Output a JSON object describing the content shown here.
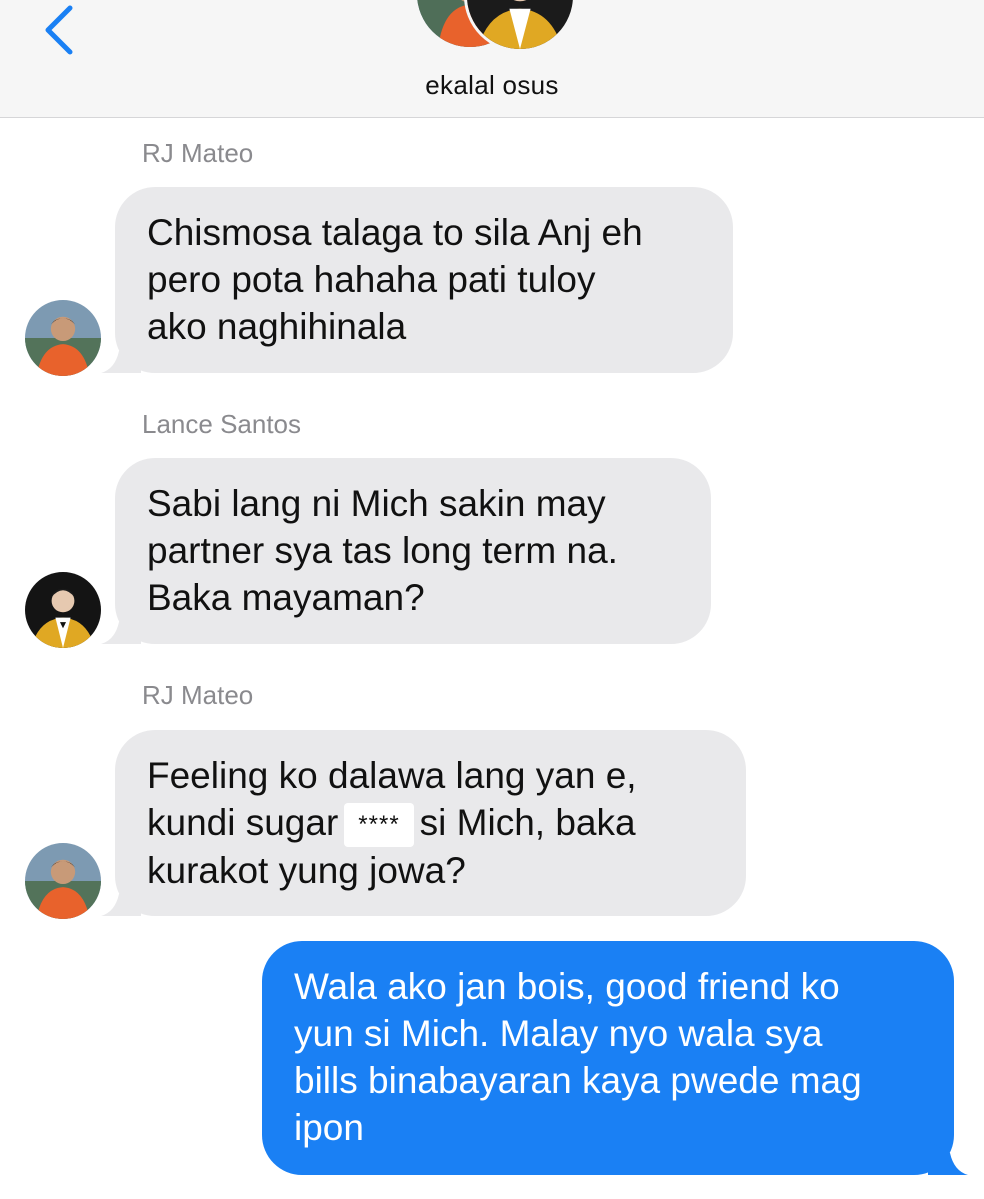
{
  "header": {
    "group_name": "ekalal osus",
    "back_icon": "chevron-left-icon"
  },
  "colors": {
    "header_bg": "#f6f6f6",
    "received_bubble": "#e9e9eb",
    "sent_bubble": "#1a80f4",
    "accent": "#1a80f4",
    "sender_name": "#8a8a8e"
  },
  "messages": [
    {
      "sender": "RJ Mateo",
      "direction": "received",
      "lines": [
        "Chismosa talaga to sila Anj eh",
        "pero pota hahaha pati tuloy",
        "ako naghihinala"
      ]
    },
    {
      "sender": "Lance Santos",
      "direction": "received",
      "lines": [
        "Sabi lang ni Mich sakin may",
        "partner sya tas long term na.",
        "Baka mayaman?"
      ]
    },
    {
      "sender": "RJ Mateo",
      "direction": "received",
      "line1": "Feeling ko dalawa lang yan e,",
      "line2_pre": "kundi sugar",
      "redacted": "****",
      "line2_post": "si Mich, baka",
      "line3": "kurakot yung jowa?"
    },
    {
      "direction": "sent",
      "lines": [
        "Wala ako jan bois, good friend ko",
        "yun si Mich. Malay nyo wala sya",
        "bills binabayaran kaya pwede mag",
        "ipon"
      ]
    }
  ]
}
